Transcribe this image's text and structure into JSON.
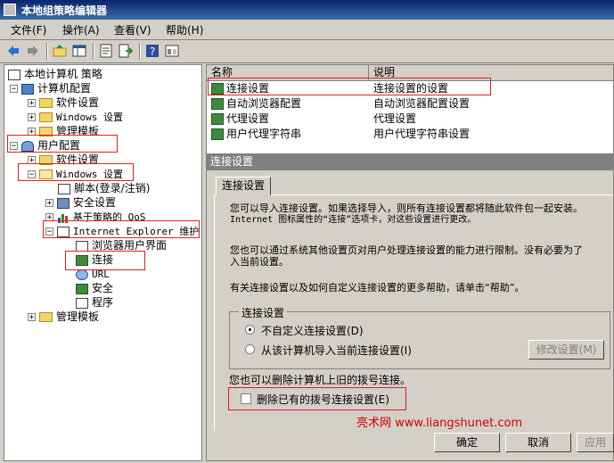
{
  "window": {
    "title": "本地组策略编辑器"
  },
  "menu": [
    "文件(F)",
    "操作(A)",
    "查看(V)",
    "帮助(H)"
  ],
  "tree": [
    {
      "label": "本地计算机 策略",
      "exp": "",
      "icon": "policy"
    },
    {
      "label": "计算机配置",
      "exp": "−",
      "icon": "computer"
    },
    {
      "label": "软件设置",
      "exp": "+",
      "icon": "folder"
    },
    {
      "label": "Windows 设置",
      "exp": "+",
      "icon": "folder"
    },
    {
      "label": "管理模板",
      "exp": "+",
      "icon": "folder"
    },
    {
      "label": "用户配置",
      "exp": "−",
      "icon": "user"
    },
    {
      "label": "软件设置",
      "exp": "+",
      "icon": "folder"
    },
    {
      "label": "Windows 设置",
      "exp": "−",
      "icon": "folder"
    },
    {
      "label": "脚本(登录/注销)",
      "exp": "",
      "icon": "script"
    },
    {
      "label": "安全设置",
      "exp": "+",
      "icon": "security"
    },
    {
      "label": "基于策略的 QoS",
      "exp": "+",
      "icon": "chart"
    },
    {
      "label": "Internet Explorer 维护",
      "exp": "−",
      "icon": "ie"
    },
    {
      "label": "浏览器用户界面",
      "exp": "",
      "icon": "ui"
    },
    {
      "label": "连接",
      "exp": "",
      "icon": "connection"
    },
    {
      "label": "URL",
      "exp": "",
      "icon": "url"
    },
    {
      "label": "安全",
      "exp": "",
      "icon": "lock"
    },
    {
      "label": "程序",
      "exp": "",
      "icon": "program"
    },
    {
      "label": "管理模板",
      "exp": "+",
      "icon": "folder"
    }
  ],
  "list": {
    "headers": [
      "名称",
      "说明"
    ],
    "rows": [
      {
        "name": "连接设置",
        "desc": "连接设置的设置"
      },
      {
        "name": "自动浏览器配置",
        "desc": "自动浏览器配置设置"
      },
      {
        "name": "代理设置",
        "desc": "代理设置"
      },
      {
        "name": "用户代理字符串",
        "desc": "用户代理字符串设置"
      }
    ]
  },
  "detail": {
    "header": "连接设置",
    "tab": "连接设置",
    "p1": "您可以导入连接设置。如果选择导入，则所有连接设置都将随此软件包一起安装。",
    "p1b": "Internet 图标属性的“连接”选项卡，对这些设置进行更改。",
    "p2": "您也可以通过系统其他设置页对用户处理连接设置的能力进行限制。没有必要为了",
    "p2b": "入当前设置。",
    "p3": "有关连接设置以及如何自定义连接设置的更多帮助，请单击“帮助”。",
    "group_title": "连接设置",
    "radio1": "不自定义连接设置(D)",
    "radio2": "从该计算机导入当前连接设置(I)",
    "modify_btn": "修改设置(M)",
    "p4": "您也可以删除计算机上旧的拨号连接。",
    "checkbox": "删除已有的拨号连接设置(E)"
  },
  "watermark": "亮术网 www.liangshunet.com",
  "buttons": {
    "ok": "确定",
    "cancel": "取消",
    "apply": "应用"
  }
}
